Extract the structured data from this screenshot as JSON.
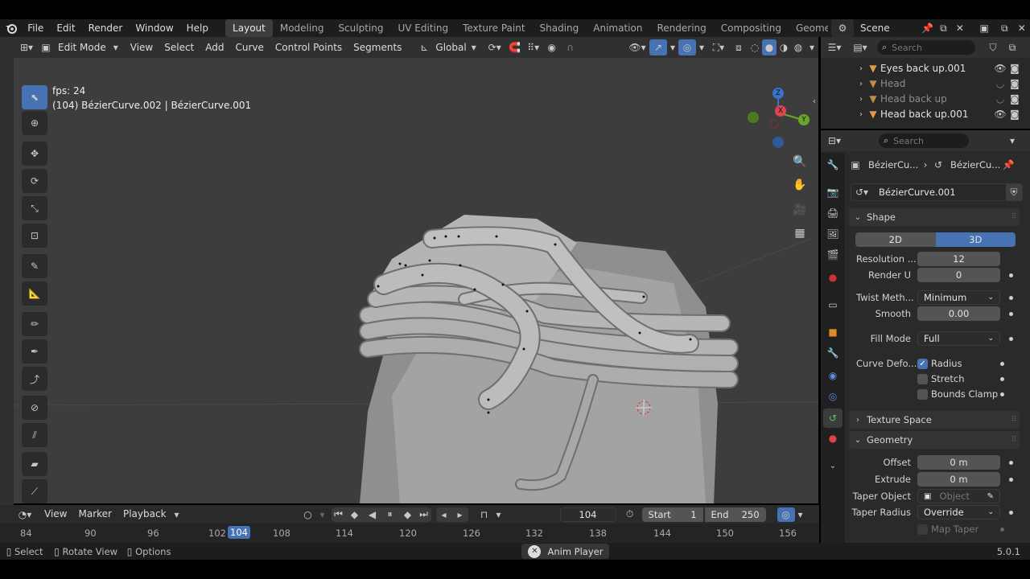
{
  "menu": {
    "items": [
      "File",
      "Edit",
      "Render",
      "Window",
      "Help"
    ]
  },
  "workspaces": [
    "Layout",
    "Modeling",
    "Sculpting",
    "UV Editing",
    "Texture Paint",
    "Shading",
    "Animation",
    "Rendering",
    "Compositing",
    "Geometry"
  ],
  "scene": "Scene",
  "viewport_header": {
    "mode": "Edit Mode",
    "menus": [
      "View",
      "Select",
      "Add",
      "Curve",
      "Control Points",
      "Segments"
    ],
    "orientation": "Global"
  },
  "overlay": {
    "fps": "fps: 24",
    "frame_info": "(104) BézierCurve.002 | BézierCurve.001"
  },
  "gizmo": {
    "z": "Z",
    "x": "X",
    "y": "Y"
  },
  "outliner": {
    "search_placeholder": "Search",
    "items": [
      {
        "label": "Eyes back up.001",
        "dim": false
      },
      {
        "label": "Head",
        "dim": true
      },
      {
        "label": "Head back up",
        "dim": true
      },
      {
        "label": "Head back up.001",
        "dim": false
      }
    ]
  },
  "properties": {
    "search_placeholder": "Search",
    "breadcrumb": [
      "BézierCu...",
      "BézierCu..."
    ],
    "datablock": "BézierCurve.001",
    "shape": {
      "title": "Shape",
      "dim_2d": "2D",
      "dim_3d": "3D",
      "resolution_label": "Resolution ...",
      "resolution": "12",
      "render_u_label": "Render U",
      "render_u": "0",
      "twist_label": "Twist Meth...",
      "twist": "Minimum",
      "smooth_label": "Smooth",
      "smooth": "0.00",
      "fill_label": "Fill Mode",
      "fill": "Full",
      "deform_label": "Curve Defo...",
      "radius": "Radius",
      "stretch": "Stretch",
      "bounds": "Bounds Clamp"
    },
    "texture_space": "Texture Space",
    "geometry": {
      "title": "Geometry",
      "offset_label": "Offset",
      "offset": "0 m",
      "extrude_label": "Extrude",
      "extrude": "0 m",
      "taper_obj_label": "Taper Object",
      "taper_obj_placeholder": "Object",
      "taper_radius_label": "Taper Radius",
      "taper_radius": "Override",
      "map_taper": "Map Taper"
    }
  },
  "timeline": {
    "menus": [
      "View",
      "Marker",
      "Playback"
    ],
    "current_frame": "104",
    "start_label": "Start",
    "start": "1",
    "end_label": "End",
    "end": "250",
    "ruler": [
      "84",
      "90",
      "96",
      "102",
      "108",
      "114",
      "120",
      "126",
      "132",
      "138",
      "144",
      "150",
      "156"
    ],
    "ruler_current": "104"
  },
  "status": {
    "select": "Select",
    "rotate": "Rotate View",
    "options": "Options",
    "center": "Anim Player",
    "version": "5.0.1"
  },
  "colors": {
    "accent": "#4772b3",
    "panel": "#2a2a2a",
    "viewport": "#3d3d3d"
  }
}
